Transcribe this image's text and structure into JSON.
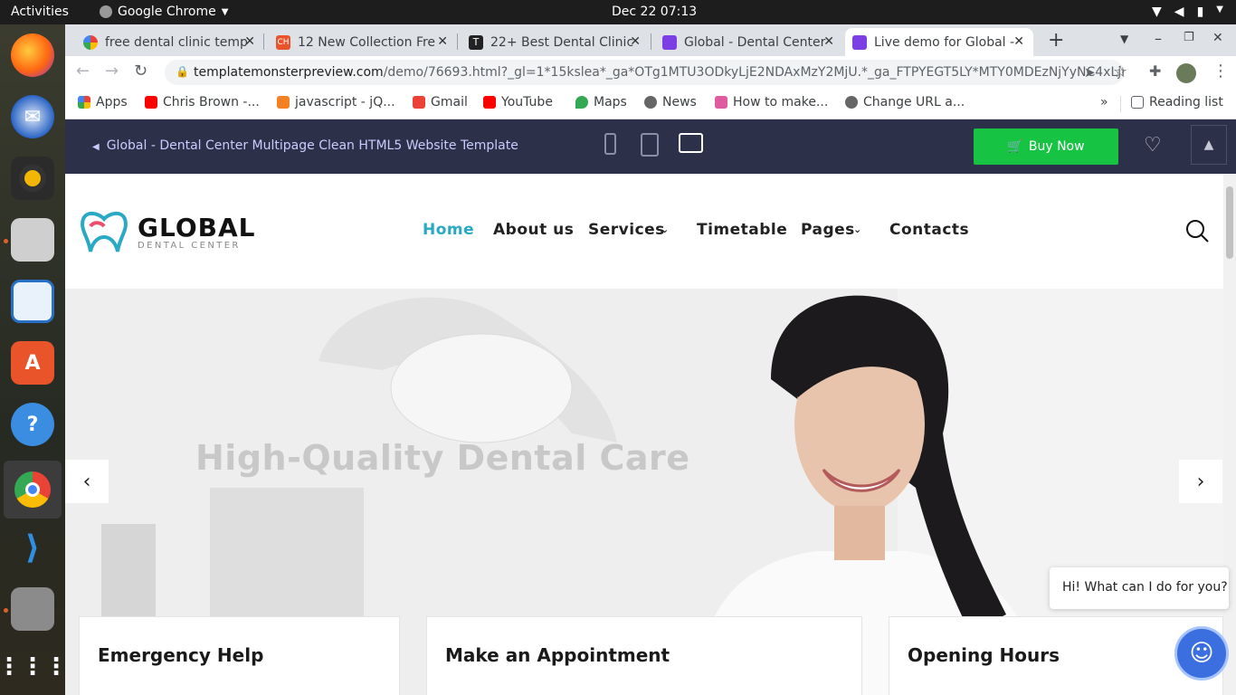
{
  "system": {
    "activities": "Activities",
    "app_name": "Google Chrome",
    "clock": "Dec 22  07:13"
  },
  "dock": {
    "items": [
      "firefox-icon",
      "thunderbird-icon",
      "rhythmbox-icon",
      "files-icon",
      "writer-icon",
      "app-center-icon",
      "help-icon",
      "chrome-icon",
      "vscode-icon",
      "archive-icon",
      "show-apps-icon"
    ]
  },
  "tabs": [
    {
      "title": "free dental clinic temp",
      "favicon": "google"
    },
    {
      "title": "12 New Collection Fre",
      "favicon": "ch"
    },
    {
      "title": "22+ Best Dental Clinic",
      "favicon": "t"
    },
    {
      "title": "Global - Dental Center",
      "favicon": "tm"
    },
    {
      "title": "Live demo for Global -",
      "favicon": "tm",
      "active": true
    }
  ],
  "address": {
    "domain": "templatemonsterpreview.com",
    "path": "/demo/76693.html?_gl=1*15kslea*_ga*OTg1MTU3ODkyLjE2NDAxMzY2MjU.*_ga_FTPYEGT5LY*MTY0MDEzNjYyNC4xLjEu..."
  },
  "bookmarks": [
    "Apps",
    "Chris Brown -...",
    "javascript - jQ...",
    "Gmail",
    "YouTube",
    "Maps",
    "News",
    "How to make...",
    "Change URL a..."
  ],
  "bookmarks_more": "»",
  "reading_list": "Reading list",
  "preview_bar": {
    "back_label": "Global - Dental Center Multipage Clean HTML5 Website Template",
    "buy_label": "Buy Now"
  },
  "site": {
    "logo_title": "GLOBAL",
    "logo_sub": "DENTAL CENTER",
    "nav": [
      {
        "label": "Home",
        "active": true
      },
      {
        "label": "About us"
      },
      {
        "label": "Services",
        "dropdown": true
      },
      {
        "label": "Timetable"
      },
      {
        "label": "Pages",
        "dropdown": true
      },
      {
        "label": "Contacts"
      }
    ],
    "hero_title": "High-Quality Dental Care",
    "cards": [
      "Emergency Help",
      "Make an Appointment",
      "Opening Hours"
    ],
    "chat_text": "Hi! What can I do for you?"
  },
  "colors": {
    "accent": "#29a9c4",
    "buy": "#16c342",
    "preview_bar": "#2c3048"
  }
}
